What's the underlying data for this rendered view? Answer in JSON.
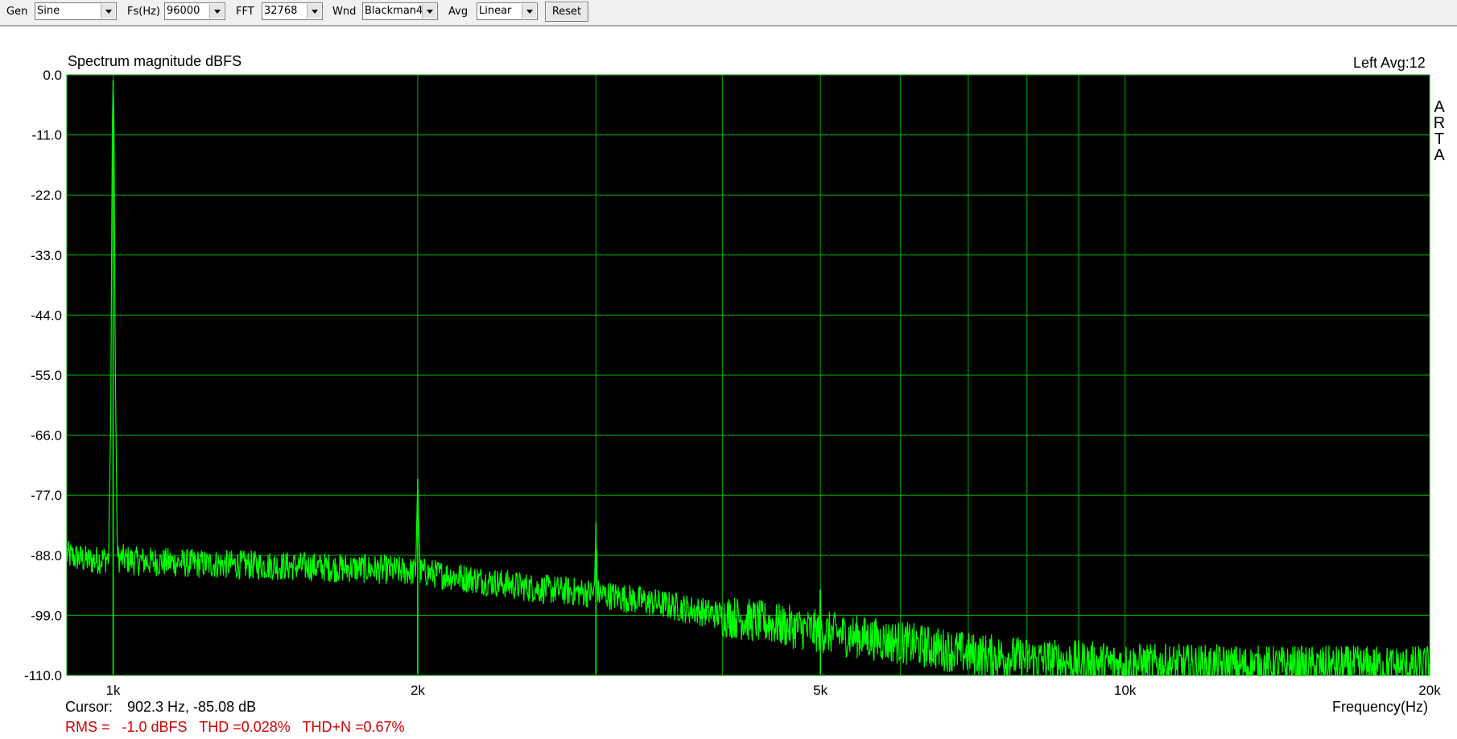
{
  "toolbar": {
    "gen_label": "Gen",
    "gen_value": "Sine",
    "fs_label": "Fs(Hz)",
    "fs_value": "96000",
    "fft_label": "FFT",
    "fft_value": "32768",
    "wnd_label": "Wnd",
    "wnd_value": "Blackman4",
    "avg_label": "Avg",
    "avg_value": "Linear",
    "reset_label": "Reset"
  },
  "chart": {
    "title": "Spectrum magnitude dBFS",
    "channel_info": "Left  Avg:12",
    "side_logo": [
      "A",
      "R",
      "T",
      "A"
    ],
    "x_axis_label": "Frequency(Hz)",
    "cursor_label": "Cursor:",
    "cursor_value": "902.3 Hz, -85.08 dB",
    "stats_line": "RMS =   -1.0 dBFS   THD =0.028%   THD+N =0.67%",
    "colors": {
      "plot_bg": "#000000",
      "grid": "#00b400",
      "trace": "#00ff00",
      "stats": "#d00000"
    }
  },
  "chart_data": {
    "type": "line",
    "title": "Spectrum magnitude dBFS",
    "xlabel": "Frequency(Hz)",
    "ylabel": "",
    "x_scale": "log",
    "xlim": [
      900,
      20000
    ],
    "ylim": [
      -110,
      0
    ],
    "yticks": [
      0,
      -11,
      -22,
      -33,
      -44,
      -55,
      -66,
      -77,
      -88,
      -99,
      -110
    ],
    "ytick_labels": [
      "0.0",
      "-11.0",
      "-22.0",
      "-33.0",
      "-44.0",
      "-55.0",
      "-66.0",
      "-77.0",
      "-88.0",
      "-99.0",
      "-110.0"
    ],
    "xtick_labels": [
      {
        "value": 1000,
        "label": "1k"
      },
      {
        "value": 2000,
        "label": "2k"
      },
      {
        "value": 5000,
        "label": "5k"
      },
      {
        "value": 10000,
        "label": "10k"
      },
      {
        "value": 20000,
        "label": "20k"
      }
    ],
    "x_gridlines": [
      1000,
      2000,
      3000,
      4000,
      5000,
      6000,
      7000,
      8000,
      9000,
      10000,
      20000
    ],
    "grid": true,
    "series": [
      {
        "x": [
          900,
          950,
          990,
          995,
          998,
          1000,
          1002,
          1005,
          1010,
          1050,
          1200,
          1500,
          1800,
          1990,
          2000,
          2010,
          2200,
          2600,
          2990,
          3000,
          3010,
          3500,
          4000,
          4990,
          5000,
          5010,
          6000,
          7000,
          8000,
          10000,
          14000,
          20000
        ],
        "y": [
          -88,
          -89,
          -88.5,
          -60,
          -10,
          -1,
          -10,
          -55,
          -88.5,
          -89,
          -89.5,
          -90,
          -90.5,
          -91,
          -74,
          -91,
          -92,
          -94,
          -95,
          -82,
          -95,
          -97,
          -99,
          -102,
          -95,
          -102,
          -104,
          -106,
          -107,
          -108,
          -108.5,
          -108.5
        ]
      }
    ]
  }
}
